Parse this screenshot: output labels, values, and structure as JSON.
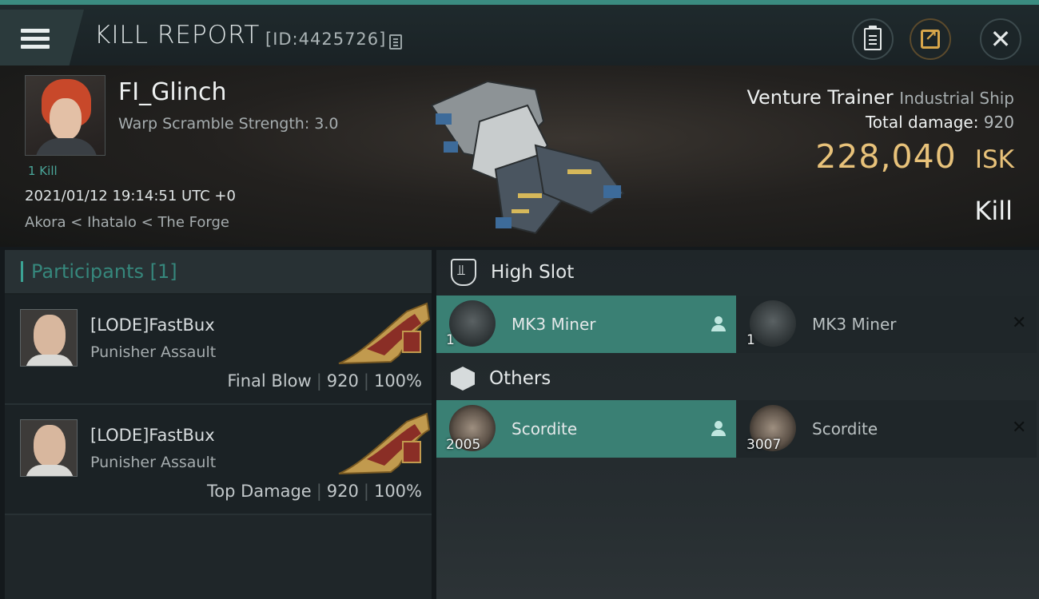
{
  "header": {
    "title": "KILL REPORT",
    "report_id": "[ID:4425726]"
  },
  "victim": {
    "pilot_name": "FI_Glinch",
    "warp_scramble": "Warp Scramble Strength: 3.0",
    "kill_tag": "1 Kill",
    "datetime": "2021/01/12 19:14:51 UTC +0",
    "location": "Akora < Ihatalo < The Forge",
    "ship_name": "Venture Trainer",
    "ship_class": "Industrial Ship",
    "total_damage_label": "Total damage:",
    "total_damage_value": "920",
    "isk_value": "228,040",
    "isk_unit": "ISK",
    "result": "Kill"
  },
  "participants": {
    "header": "Participants [1]",
    "list": [
      {
        "name": "[LODE]FastBux",
        "ship": "Punisher Assault",
        "tag": "Final Blow",
        "damage": "920",
        "percent": "100%"
      },
      {
        "name": "[LODE]FastBux",
        "ship": "Punisher Assault",
        "tag": "Top Damage",
        "damage": "920",
        "percent": "100%"
      }
    ]
  },
  "items": {
    "high_slot_label": "High Slot",
    "others_label": "Others",
    "high_slot": [
      {
        "name": "MK3 Miner",
        "qty": "1"
      },
      {
        "name": "MK3 Miner",
        "qty": "1"
      }
    ],
    "others": [
      {
        "name": "Scordite",
        "qty": "2005"
      },
      {
        "name": "Scordite",
        "qty": "3007"
      }
    ]
  },
  "colors": {
    "accent": "#3a8074",
    "isk": "#e8c27a",
    "participants_header": "#36877c"
  },
  "icons": [
    "menu-icon",
    "copy-icon",
    "clipboard-icon",
    "share-icon",
    "close-icon",
    "high-slot-icon",
    "cargo-box-icon",
    "person-icon",
    "x-icon"
  ]
}
